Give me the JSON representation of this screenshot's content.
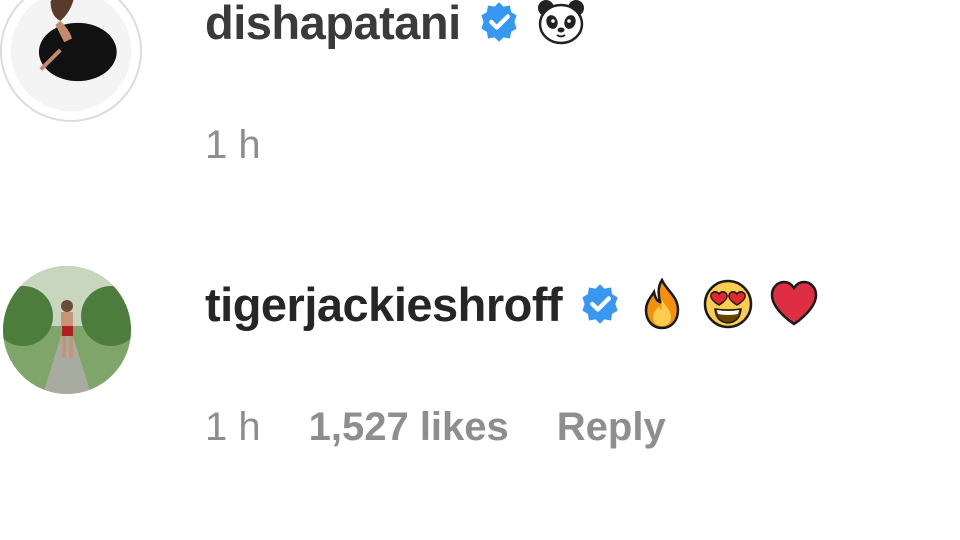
{
  "comments": [
    {
      "username": "dishapatani",
      "verified": true,
      "verified_icon": "verified-badge-icon",
      "emojis": [
        "panda-face-emoji"
      ],
      "time": "1 h"
    },
    {
      "username": "tigerjackieshroff",
      "verified": true,
      "verified_icon": "verified-badge-icon",
      "emojis": [
        "fire-emoji",
        "heart-eyes-emoji",
        "red-heart-emoji"
      ],
      "time": "1 h",
      "likes": "1,527 likes",
      "reply_label": "Reply"
    }
  ],
  "colors": {
    "username": "#262626",
    "meta": "#8e8e8e",
    "verified": "#3897f0",
    "background": "#ffffff"
  }
}
